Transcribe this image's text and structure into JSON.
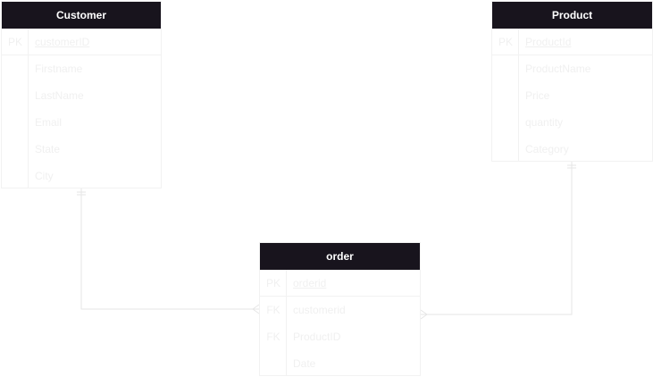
{
  "entities": {
    "customer": {
      "title": "Customer",
      "pk_marker": "PK",
      "pk_field": "customerID",
      "fields": [
        "Firstname",
        "LastName",
        "Email",
        "State",
        "City"
      ]
    },
    "product": {
      "title": "Product",
      "pk_marker": "PK",
      "pk_field": "ProductId",
      "fields": [
        "ProductName",
        "Price",
        "quantity",
        "Category"
      ]
    },
    "order": {
      "title": "order",
      "pk_marker": "PK",
      "pk_field": "orderid",
      "fk_marker": "FK",
      "fields": [
        "customerid",
        "ProductID",
        "Date"
      ]
    }
  },
  "colors": {
    "header_bg": "#18141d",
    "header_text": "#ffffff",
    "faint_text": "#f0f0f0",
    "border": "#f2f2f2",
    "connector": "#e6e6e6"
  }
}
